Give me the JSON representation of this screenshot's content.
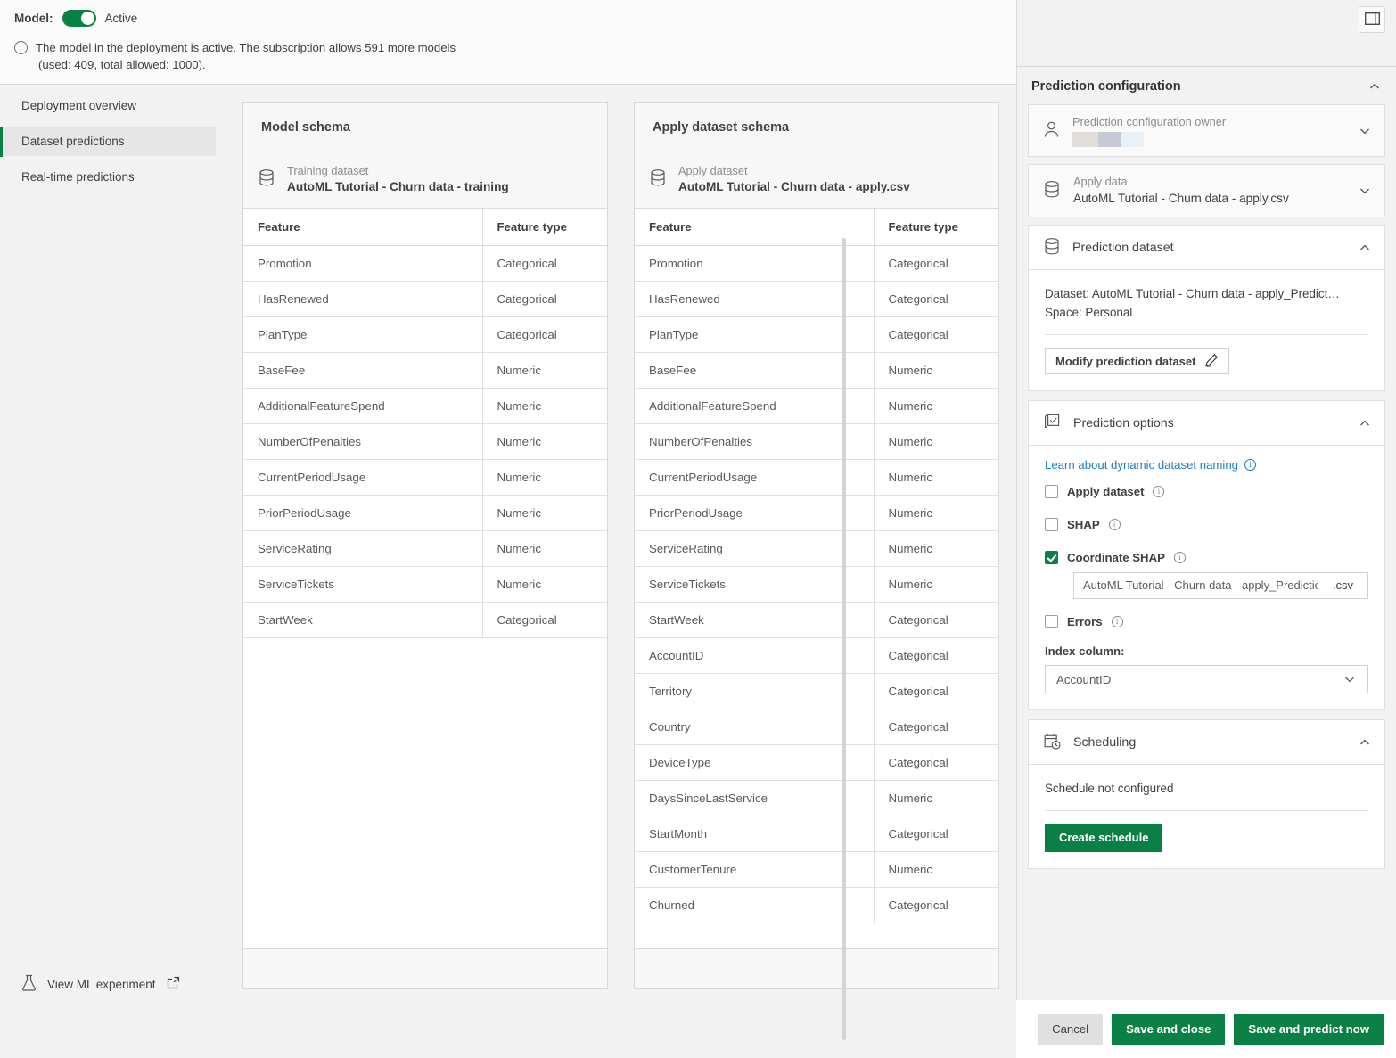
{
  "header": {
    "model_label": "Model:",
    "toggle_state": "Active",
    "toggle_on": true,
    "notice_line1": "The model in the deployment is active. The subscription allows 591 more models",
    "notice_line2": "(used: 409, total allowed: 1000)."
  },
  "sidebar": {
    "items": [
      {
        "label": "Deployment overview",
        "active": false
      },
      {
        "label": "Dataset predictions",
        "active": true
      },
      {
        "label": "Real-time predictions",
        "active": false
      }
    ],
    "footer_link": "View ML experiment"
  },
  "model_schema": {
    "title": "Model schema",
    "dataset_kind": "Training dataset",
    "dataset_name": "AutoML Tutorial - Churn data - training",
    "columns": [
      "Feature",
      "Feature type"
    ],
    "rows": [
      [
        "Promotion",
        "Categorical"
      ],
      [
        "HasRenewed",
        "Categorical"
      ],
      [
        "PlanType",
        "Categorical"
      ],
      [
        "BaseFee",
        "Numeric"
      ],
      [
        "AdditionalFeatureSpend",
        "Numeric"
      ],
      [
        "NumberOfPenalties",
        "Numeric"
      ],
      [
        "CurrentPeriodUsage",
        "Numeric"
      ],
      [
        "PriorPeriodUsage",
        "Numeric"
      ],
      [
        "ServiceRating",
        "Numeric"
      ],
      [
        "ServiceTickets",
        "Numeric"
      ],
      [
        "StartWeek",
        "Categorical"
      ]
    ]
  },
  "apply_schema": {
    "title": "Apply dataset schema",
    "dataset_kind": "Apply dataset",
    "dataset_name": "AutoML Tutorial - Churn data - apply.csv",
    "columns": [
      "Feature",
      "Feature type"
    ],
    "rows": [
      [
        "Promotion",
        "Categorical"
      ],
      [
        "HasRenewed",
        "Categorical"
      ],
      [
        "PlanType",
        "Categorical"
      ],
      [
        "BaseFee",
        "Numeric"
      ],
      [
        "AdditionalFeatureSpend",
        "Numeric"
      ],
      [
        "NumberOfPenalties",
        "Numeric"
      ],
      [
        "CurrentPeriodUsage",
        "Numeric"
      ],
      [
        "PriorPeriodUsage",
        "Numeric"
      ],
      [
        "ServiceRating",
        "Numeric"
      ],
      [
        "ServiceTickets",
        "Numeric"
      ],
      [
        "StartWeek",
        "Categorical"
      ],
      [
        "AccountID",
        "Categorical"
      ],
      [
        "Territory",
        "Categorical"
      ],
      [
        "Country",
        "Categorical"
      ],
      [
        "DeviceType",
        "Categorical"
      ],
      [
        "DaysSinceLastService",
        "Numeric"
      ],
      [
        "StartMonth",
        "Categorical"
      ],
      [
        "CustomerTenure",
        "Numeric"
      ],
      [
        "Churned",
        "Categorical"
      ]
    ]
  },
  "right_panel": {
    "title": "Prediction configuration",
    "owner": {
      "kind": "Prediction configuration owner",
      "redacted": true,
      "redact_colors": [
        "#e2ded9",
        "#c5cad4",
        "#eaf0f7"
      ]
    },
    "apply_data": {
      "kind": "Apply data",
      "value": "AutoML Tutorial - Churn data - apply.csv"
    },
    "prediction_dataset": {
      "title": "Prediction dataset",
      "dataset_line": "Dataset: AutoML Tutorial - Churn data - apply_Predict…",
      "space_line": "Space: Personal",
      "modify_button": "Modify prediction dataset"
    },
    "prediction_options": {
      "title": "Prediction options",
      "learn_link": "Learn about dynamic dataset naming",
      "checkboxes": [
        {
          "label": "Apply dataset",
          "checked": false
        },
        {
          "label": "SHAP",
          "checked": false
        },
        {
          "label": "Coordinate SHAP",
          "checked": true
        },
        {
          "label": "Errors",
          "checked": false
        }
      ],
      "filename_value": "AutoML Tutorial - Churn data - apply_Predictio",
      "filename_ext": ".csv",
      "index_label": "Index column:",
      "index_value": "AccountID"
    },
    "scheduling": {
      "title": "Scheduling",
      "status": "Schedule not configured",
      "create_button": "Create schedule"
    }
  },
  "action_bar": {
    "cancel": "Cancel",
    "save_and_close": "Save and close",
    "save_and_predict": "Save and predict now"
  },
  "colors": {
    "accent_green": "#0a8044",
    "link_blue": "#1a7dc4",
    "panel_bg": "#f2f2f2"
  }
}
